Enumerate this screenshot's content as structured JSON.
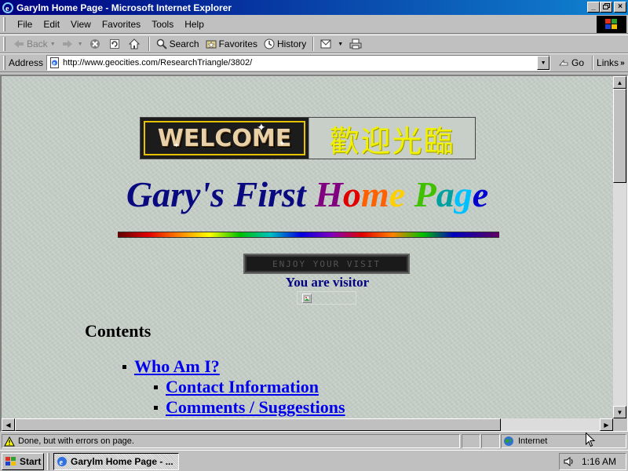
{
  "window": {
    "title": "Garylm Home Page - Microsoft Internet Explorer",
    "minimize_glyph": "_",
    "maximize_glyph": "▫",
    "close_glyph": "×"
  },
  "menu": {
    "items": [
      "File",
      "Edit",
      "View",
      "Favorites",
      "Tools",
      "Help"
    ]
  },
  "toolbar": {
    "back_label": "Back",
    "forward_label": "",
    "stop_icon": "stop-icon",
    "refresh_icon": "refresh-icon",
    "home_icon": "home-icon",
    "search_label": "Search",
    "favorites_label": "Favorites",
    "history_label": "History"
  },
  "address": {
    "label": "Address",
    "url": "http://www.geocities.com/ResearchTriangle/3802/",
    "go_label": "Go",
    "links_label": "Links",
    "links_more": "»"
  },
  "page": {
    "welcome_text": "WELCOME",
    "welcome_chinese": "歡迎光臨",
    "title_part1": "Gary's First ",
    "title_H": "H",
    "title_o": "o",
    "title_m": "m",
    "title_e1": "e",
    "title_space": " ",
    "title_P": "P",
    "title_a": "a",
    "title_g": "g",
    "title_e2": "e",
    "marquee_text": "ENJOY YOUR VISIT",
    "visitor_label": "You are visitor",
    "contents_heading": "Contents",
    "links": [
      {
        "label": "Who Am I?"
      },
      {
        "label": "Contact Information"
      },
      {
        "label": "Comments / Suggestions"
      }
    ]
  },
  "status": {
    "text": "Done, but with errors on page.",
    "zone": "Internet"
  },
  "taskbar": {
    "start_label": "Start",
    "task_label": "Garylm Home Page - ...",
    "clock": "1:16 AM"
  },
  "colors": {
    "titlebar_start": "#000080",
    "titlebar_end": "#1084d0",
    "title_text": "#0a0a80",
    "link": "#0000ee",
    "page_bg": "#c2cbc3"
  }
}
